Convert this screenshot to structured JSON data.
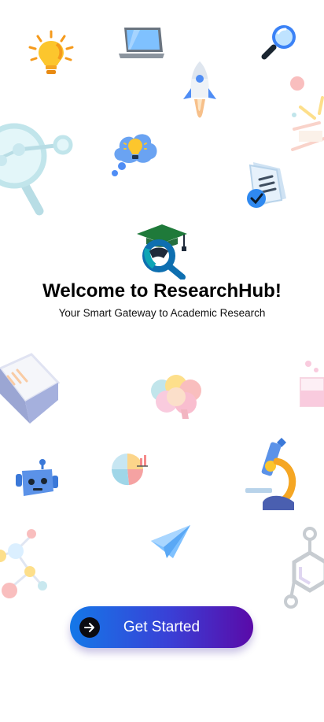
{
  "welcome": {
    "title": "Welcome to ResearchHub!",
    "subtitle": "Your Smart Gateway to Academic Research"
  },
  "cta": {
    "label": "Get Started",
    "icon": "arrow-right-icon"
  },
  "colors": {
    "cta_start": "#1478e8",
    "cta_end": "#5a0aa8",
    "logo_cap": "#1f7a3a",
    "logo_lens": "#0e6fb0"
  },
  "decorations": [
    "lightbulb-icon",
    "laptop-icon",
    "rocket-icon",
    "magnifier-icon",
    "molecule-magnifier-icon",
    "idea-cloud-icon",
    "confetti-icon",
    "document-check-icon",
    "open-book-icon",
    "brain-icon",
    "flask-icon",
    "robot-icon",
    "pie-chart-icon",
    "microscope-icon",
    "molecule-icon",
    "paper-plane-icon",
    "hexagon-molecule-icon"
  ]
}
